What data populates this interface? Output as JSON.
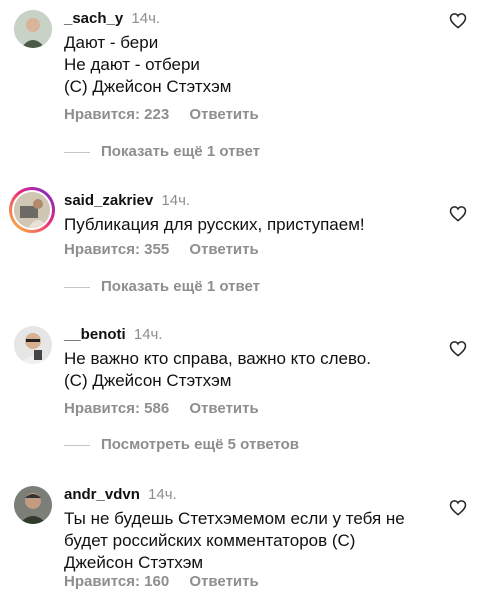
{
  "comments": [
    {
      "username": "_sach_y",
      "time": "14ч.",
      "lines": [
        "Дают - бери",
        "Не дают - отбери",
        "(С) Джейсон Стэтхэм"
      ],
      "likes": "Нравится: 223",
      "reply": "Ответить",
      "more_replies": "Показать ещё 1 ответ"
    },
    {
      "username": "said_zakriev",
      "time": "14ч.",
      "lines": [
        "Публикация для русских, приступаем!"
      ],
      "likes": "Нравится: 355",
      "reply": "Ответить",
      "more_replies": "Показать ещё 1 ответ"
    },
    {
      "username": "__benoti",
      "time": "14ч.",
      "lines": [
        "Не важно кто справа, важно кто слево.",
        "(С) Джейсон Стэтхэм"
      ],
      "likes": "Нравится: 586",
      "reply": "Ответить",
      "more_replies": "Посмотреть ещё 5 ответов"
    },
    {
      "username": "andr_vdvn",
      "time": "14ч.",
      "lines": [
        "Ты не будешь Стетхэмемом  если у тебя не",
        "будет российских комментаторов (С)",
        "Джейсон Стэтхэм"
      ],
      "likes": "Нравится: 160",
      "reply": "Ответить"
    }
  ],
  "icons": {
    "like": "heart-outline-icon"
  },
  "colors": {
    "meta_text": "#8e8e8e",
    "story_ring": "#ee2a7b"
  }
}
